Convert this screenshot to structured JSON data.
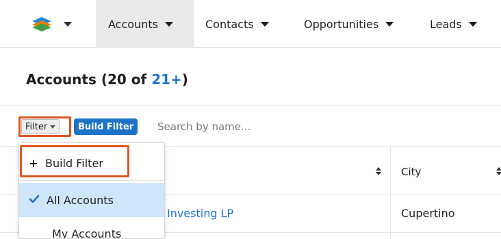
{
  "nav": {
    "tabs": [
      {
        "label": "Accounts"
      },
      {
        "label": "Contacts"
      },
      {
        "label": "Opportunities"
      },
      {
        "label": "Leads"
      }
    ]
  },
  "header": {
    "title_prefix": "Accounts (20 of ",
    "title_count_link": "21+",
    "title_suffix": ")"
  },
  "filter_bar": {
    "filter_label": "Filter",
    "build_filter_label": "Build Filter",
    "search_placeholder": "Search by name..."
  },
  "table": {
    "columns": [
      {
        "label": ""
      },
      {
        "label": "City"
      }
    ],
    "rows": [
      {
        "name": "Investing LP",
        "city": "Cupertino"
      }
    ]
  },
  "filter_menu": {
    "items": [
      {
        "label": "Build Filter"
      },
      {
        "label": "All Accounts",
        "selected": true
      },
      {
        "label": "My Accounts"
      }
    ]
  },
  "colors": {
    "accent_blue": "#1e73c8",
    "link_blue": "#1a73d6",
    "highlight_orange": "#e0561f",
    "selected_bg": "#cfe6fb"
  }
}
